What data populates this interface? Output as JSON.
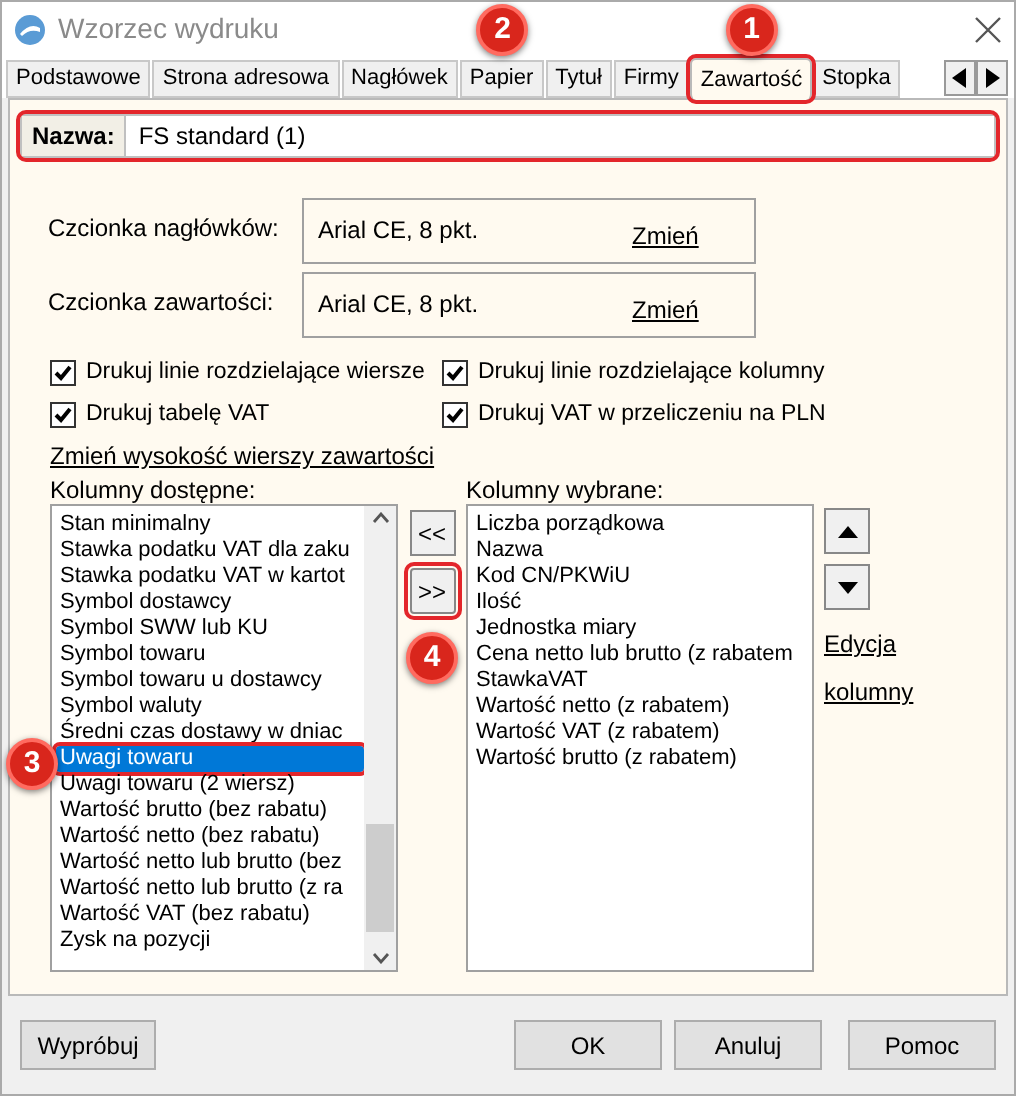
{
  "window": {
    "title": "Wzorzec wydruku"
  },
  "tabs": [
    {
      "label": "Podstawowe",
      "selected": false
    },
    {
      "label": "Strona adresowa",
      "selected": false
    },
    {
      "label": "Nagłówek",
      "selected": false
    },
    {
      "label": "Papier",
      "selected": false,
      "annotation": "2"
    },
    {
      "label": "Tytuł",
      "selected": false
    },
    {
      "label": "Firmy",
      "selected": false
    },
    {
      "label": "Zawartość",
      "selected": true,
      "highlighted": true,
      "annotation": "1"
    },
    {
      "label": "Stopka",
      "selected": false
    }
  ],
  "name_field": {
    "label": "Nazwa:",
    "value": "FS standard (1)",
    "highlighted": true
  },
  "fonts": [
    {
      "label": "Czcionka nagłówków:",
      "value": "Arial CE, 8 pkt.",
      "link": "Zmień"
    },
    {
      "label": "Czcionka zawartości:",
      "value": "Arial CE, 8 pkt.",
      "link": "Zmień"
    }
  ],
  "checkboxes": [
    {
      "label": "Drukuj linie rozdzielające wiersze",
      "checked": true
    },
    {
      "label": "Drukuj linie rozdzielające kolumny",
      "checked": true
    },
    {
      "label": "Drukuj tabelę VAT",
      "checked": true
    },
    {
      "label": "Drukuj VAT w przeliczeniu na PLN",
      "checked": true
    }
  ],
  "row_height_link": "Zmień wysokość wierszy zawartości",
  "available_columns": {
    "label": "Kolumny dostępne:",
    "items": [
      {
        "text": "Stan minimalny",
        "selected": false
      },
      {
        "text": "Stawka podatku VAT dla zaku",
        "selected": false
      },
      {
        "text": "Stawka podatku VAT w kartot",
        "selected": false
      },
      {
        "text": "Symbol dostawcy",
        "selected": false
      },
      {
        "text": "Symbol SWW lub KU",
        "selected": false
      },
      {
        "text": "Symbol towaru",
        "selected": false
      },
      {
        "text": "Symbol towaru u dostawcy",
        "selected": false
      },
      {
        "text": "Symbol waluty",
        "selected": false
      },
      {
        "text": "Średni czas dostawy w dniac",
        "selected": false
      },
      {
        "text": "Uwagi towaru",
        "selected": true,
        "highlighted": true,
        "annotation": "3"
      },
      {
        "text": "Uwagi towaru (2 wiersz)",
        "selected": false
      },
      {
        "text": "Wartość brutto (bez rabatu)",
        "selected": false
      },
      {
        "text": "Wartość netto (bez rabatu)",
        "selected": false
      },
      {
        "text": "Wartość netto lub brutto (bez",
        "selected": false
      },
      {
        "text": "Wartość netto lub brutto (z ra",
        "selected": false
      },
      {
        "text": "Wartość VAT (bez rabatu)",
        "selected": false
      },
      {
        "text": "Zysk na pozycji",
        "selected": false
      }
    ]
  },
  "move_buttons": [
    {
      "label": "<<",
      "highlighted": false
    },
    {
      "label": ">>",
      "highlighted": true,
      "annotation": "4"
    }
  ],
  "selected_columns": {
    "label": "Kolumny wybrane:",
    "items": [
      {
        "text": "Liczba porządkowa",
        "selected": false
      },
      {
        "text": "Nazwa",
        "selected": false
      },
      {
        "text": "Kod CN/PKWiU",
        "selected": false
      },
      {
        "text": "Ilość",
        "selected": false
      },
      {
        "text": "Jednostka miary",
        "selected": false
      },
      {
        "text": "Cena netto lub brutto (z rabatem",
        "selected": false
      },
      {
        "text": "StawkaVAT",
        "selected": false
      },
      {
        "text": "Wartość netto (z rabatem)",
        "selected": false
      },
      {
        "text": "Wartość VAT (z rabatem)",
        "selected": false
      },
      {
        "text": "Wartość brutto (z rabatem)",
        "selected": false
      }
    ]
  },
  "edit_links": [
    "Edycja",
    "kolumny"
  ],
  "buttons": [
    {
      "label": "Wypróbuj"
    },
    {
      "label": "OK"
    },
    {
      "label": "Anuluj"
    },
    {
      "label": "Pomoc"
    }
  ]
}
